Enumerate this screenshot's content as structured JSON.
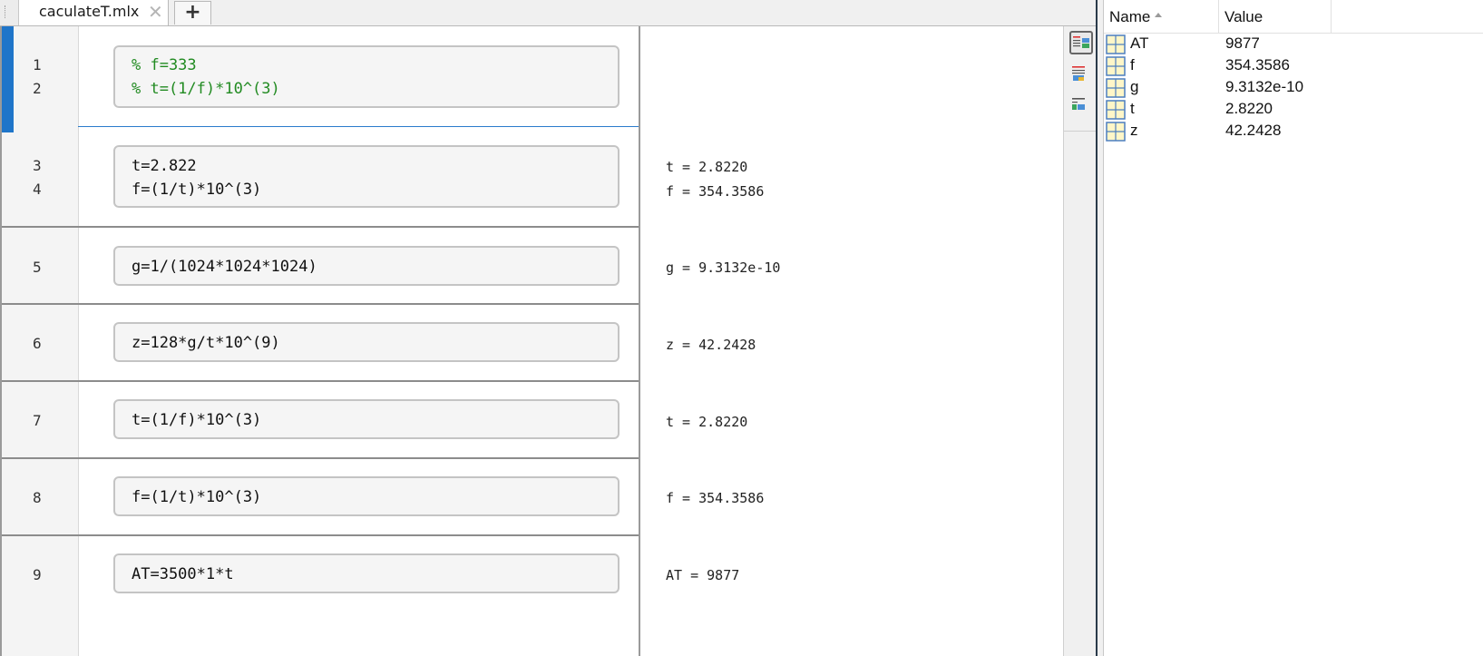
{
  "tab": {
    "filename": "caculateT.mlx",
    "close_glyph": "✕",
    "add_glyph": "+"
  },
  "sections": [
    {
      "line_numbers": [
        "1",
        "2"
      ],
      "code": [
        "% f=333",
        "% t=(1/f)*10^(3)"
      ],
      "is_comment": true,
      "outputs": []
    },
    {
      "line_numbers": [
        "3",
        "4"
      ],
      "code": [
        "t=2.822",
        "f=(1/t)*10^(3)"
      ],
      "is_comment": false,
      "outputs": [
        "t = 2.8220",
        "f = 354.3586"
      ]
    },
    {
      "line_numbers": [
        "5"
      ],
      "code": [
        "g=1/(1024*1024*1024)"
      ],
      "is_comment": false,
      "outputs": [
        "g = 9.3132e-10"
      ]
    },
    {
      "line_numbers": [
        "6"
      ],
      "code": [
        "z=128*g/t*10^(9)"
      ],
      "is_comment": false,
      "outputs": [
        "z = 42.2428"
      ]
    },
    {
      "line_numbers": [
        "7"
      ],
      "code": [
        "t=(1/f)*10^(3)"
      ],
      "is_comment": false,
      "outputs": [
        "t = 2.8220"
      ]
    },
    {
      "line_numbers": [
        "8"
      ],
      "code": [
        "f=(1/t)*10^(3)"
      ],
      "is_comment": false,
      "outputs": [
        "f = 354.3586"
      ]
    },
    {
      "line_numbers": [
        "9"
      ],
      "code": [
        "AT=3500*1*t"
      ],
      "is_comment": false,
      "outputs": [
        "AT = 9877"
      ]
    }
  ],
  "toolbar_icons": [
    "output-right-icon",
    "output-inline-icon",
    "hide-code-icon"
  ],
  "workspace": {
    "columns": [
      "Name",
      "Value"
    ],
    "variables": [
      {
        "name": "AT",
        "value": "9877",
        "icon": "matrix-icon"
      },
      {
        "name": "f",
        "value": "354.3586",
        "icon": "matrix-icon"
      },
      {
        "name": "g",
        "value": "9.3132e-10",
        "icon": "matrix-icon"
      },
      {
        "name": "t",
        "value": "2.8220",
        "icon": "matrix-icon"
      },
      {
        "name": "z",
        "value": "42.2428",
        "icon": "matrix-icon"
      }
    ]
  },
  "colors": {
    "comment": "#228b22",
    "active_section": "#1f75c9"
  }
}
